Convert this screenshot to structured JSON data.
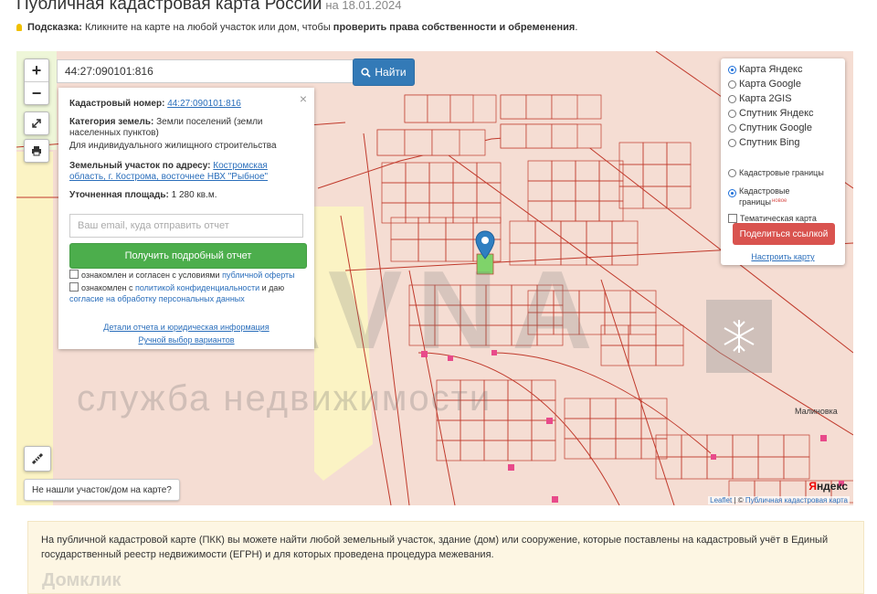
{
  "header": {
    "title": "Публичная кадастровая карта России",
    "date": "на 18.01.2024"
  },
  "hint": {
    "label": "Подсказка:",
    "text": "Кликните на карте на любой участок или дом, чтобы",
    "bold": "проверить права собственности и обременения",
    "end": "."
  },
  "map": {
    "zoom_in": "+",
    "zoom_out": "−",
    "search_value": "44:27:090101:816",
    "search_button": "Найти",
    "not_found_button": "Не нашли участок/дом на карте?",
    "town_label": "Малиновка",
    "yandex_logo_y": "Я",
    "yandex_logo_rest": "ндекс",
    "attribution_leaflet": "Leaflet",
    "attribution_sep": " | © ",
    "attribution_link": "Публичная кадастровая карта",
    "watermark_big": "SLAVNA",
    "watermark_small": "служба недвижимости"
  },
  "info_popup": {
    "close": "×",
    "cadastral_label": "Кадастровый номер:",
    "cadastral_number": "44:27:090101:816",
    "category_label": "Категория земель:",
    "category_value": "Земли поселений (земли населенных пунктов)",
    "usage": "Для индивидуального жилищного строительства",
    "address_label": "Земельный участок по адресу:",
    "address_value": "Костромская область, г. Кострома, восточнее НВХ \"Рыбное\"",
    "area_label": "Уточненная площадь:",
    "area_value": "1 280 кв.м.",
    "email_placeholder": "Ваш email, куда отправить отчет",
    "report_button": "Получить подробный отчет",
    "consent1_text": "ознакомлен и согласен с условиями",
    "consent1_link": "публичной оферты",
    "consent2_text": "ознакомлен с",
    "consent2_link": "политикой конфиденциальности",
    "consent2_mid": "и даю",
    "consent2_link2": "согласие на обработку персональных данных",
    "details_link": "Детали отчета и юридическая информация",
    "manual_link": "Ручной выбор вариантов"
  },
  "layers": {
    "base": [
      {
        "label": "Карта Яндекс",
        "selected": true
      },
      {
        "label": "Карта Google",
        "selected": false
      },
      {
        "label": "Карта 2GIS",
        "selected": false
      },
      {
        "label": "Спутник Яндекс",
        "selected": false
      },
      {
        "label": "Спутник Google",
        "selected": false
      },
      {
        "label": "Спутник Bing",
        "selected": false
      }
    ],
    "boundaries_old": "Кадастровые границы",
    "boundaries_new": "Кадастровые границы",
    "new_badge": "новое",
    "thematic": "Тематическая карта",
    "share_button": "Поделиться ссылкой",
    "configure_link": "Настроить карту"
  },
  "description": {
    "text": "На публичной кадастровой карте (ПКК) вы можете найти любой земельный участок, здание (дом) или сооружение, которые поставлены на кадастровый учёт в Единый государственный реестр недвижимости (ЕГРН) и для которых проведена процедура межевания.",
    "watermark": "Домклик"
  },
  "colors": {
    "parcel_fill": "#f5ddd3",
    "parcel_line": "#c0392b",
    "search_button": "#337ab7",
    "report_button": "#4cae4c",
    "share_button": "#d9534f",
    "description_bg": "#fdf6e3"
  }
}
